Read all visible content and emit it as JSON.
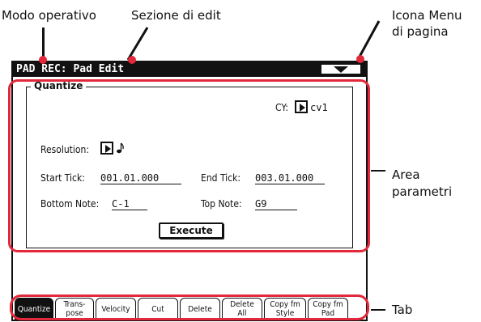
{
  "annotations": {
    "mode": "Modo operativo",
    "edit_section": "Sezione di edit",
    "menu_icon_line1": "Icona Menu",
    "menu_icon_line2": "di pagina",
    "param_area_line1": "Area",
    "param_area_line2": "parametri",
    "tab": "Tab"
  },
  "colors": {
    "highlight": "#e2283a",
    "titlebar": "#111111"
  },
  "screen": {
    "title": "PAD REC: Pad Edit",
    "menu_icon": "triangle-down-icon",
    "group_title": "Quantize",
    "cy_label": "CY:",
    "cy_value": "cv1",
    "resolution_label": "Resolution:",
    "resolution_icon": "eighth-note-icon",
    "start_tick_label": "Start Tick:",
    "start_tick_value": "001.01.000",
    "end_tick_label": "End Tick:",
    "end_tick_value": "003.01.000",
    "bottom_note_label": "Bottom Note:",
    "bottom_note_value": "C-1",
    "top_note_label": "Top Note:",
    "top_note_value": "G9",
    "execute_label": "Execute"
  },
  "tabs": [
    {
      "line1": "Quantize",
      "line2": "",
      "active": true
    },
    {
      "line1": "Trans-",
      "line2": "pose",
      "active": false
    },
    {
      "line1": "Velocity",
      "line2": "",
      "active": false
    },
    {
      "line1": "Cut",
      "line2": "",
      "active": false
    },
    {
      "line1": "Delete",
      "line2": "",
      "active": false
    },
    {
      "line1": "Delete",
      "line2": "All",
      "active": false
    },
    {
      "line1": "Copy fm",
      "line2": "Style",
      "active": false
    },
    {
      "line1": "Copy fm",
      "line2": "Pad",
      "active": false
    }
  ]
}
